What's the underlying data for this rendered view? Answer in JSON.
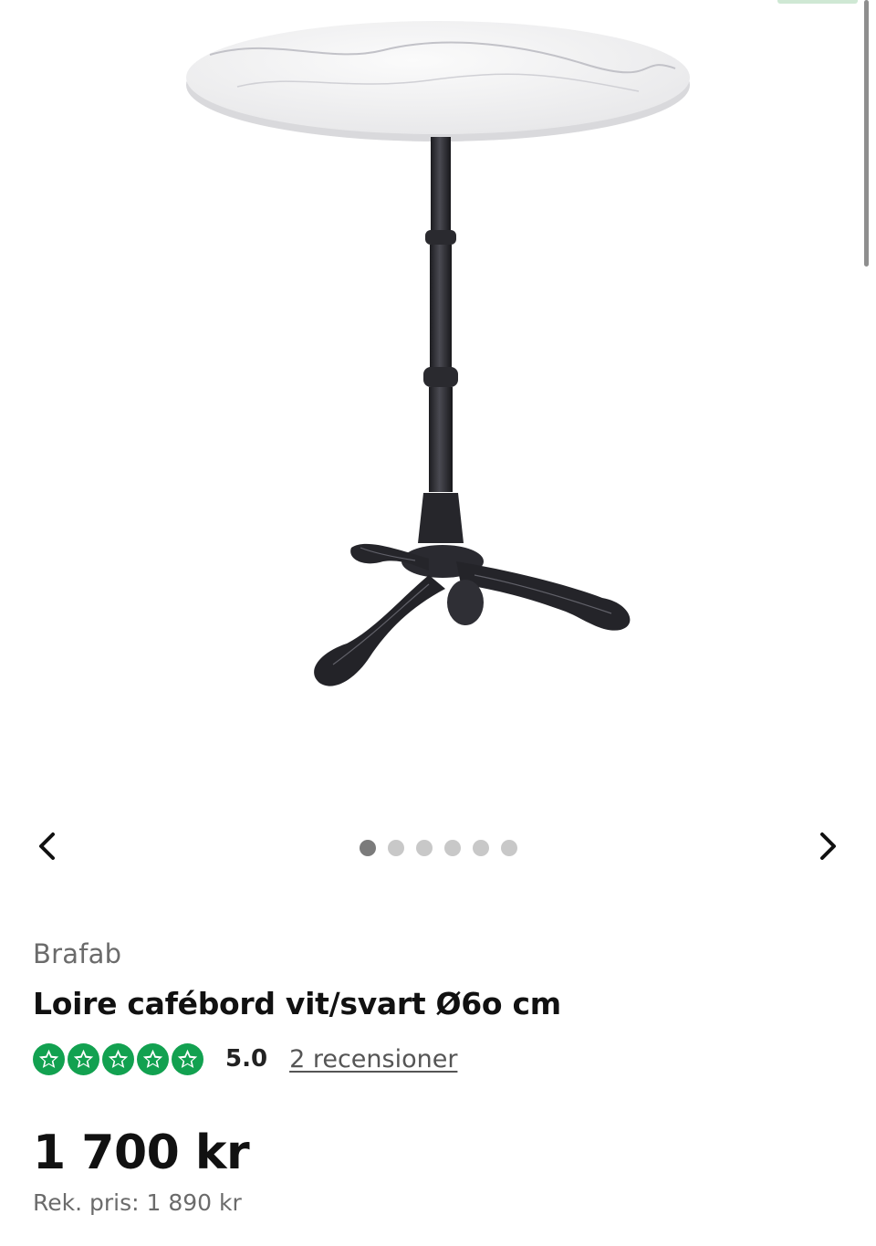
{
  "gallery": {
    "image_alt": "Loire cafébord vit/svart Ø60 cm",
    "prev_icon": "chevron-left-icon",
    "next_icon": "chevron-right-icon",
    "slide_count": 6,
    "active_slide": 1
  },
  "product": {
    "brand": "Brafab",
    "title": "Loire cafébord vit/svart Ø6o cm",
    "rating": {
      "stars": 5,
      "score": "5.0",
      "reviews_label": "2 recensioner",
      "star_color": "#12a150"
    },
    "price": "1 700 kr",
    "recommended_price": "Rek. pris: 1 890 kr"
  },
  "colors": {
    "accent_green": "#12a150",
    "text_primary": "#111111",
    "text_secondary": "#6b6b6b"
  }
}
